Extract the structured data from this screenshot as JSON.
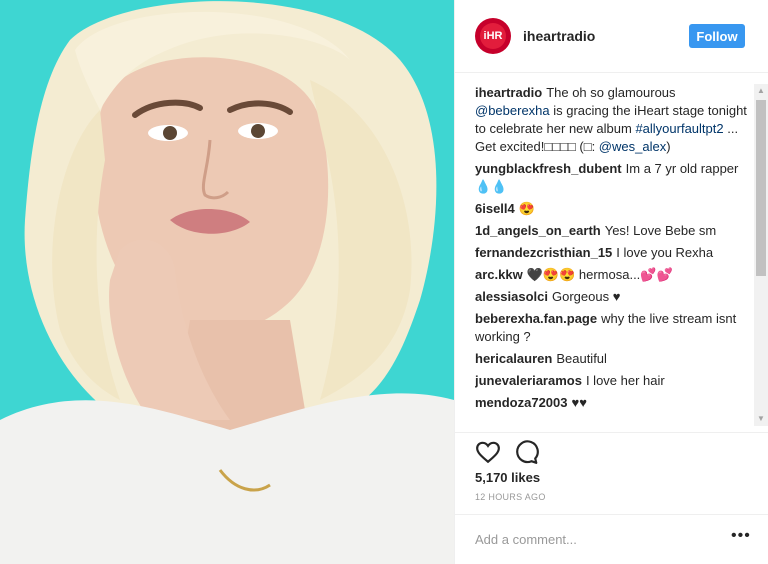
{
  "post": {
    "username": "iheartradio",
    "follow_label": "Follow",
    "caption_user": "iheartradio",
    "caption_parts": [
      "The oh so glamourous ",
      "@beberexha",
      " is gracing the iHeart stage tonight to celebrate her new album ",
      "#allyourfaultpt2",
      " ... Get excited!□□□□ (□: ",
      "@wes_alex",
      ")"
    ],
    "likes": "5,170 likes",
    "time": "12 HOURS AGO",
    "add_comment_placeholder": "Add a comment...",
    "more_label": "•••",
    "avatar_text": "iHR"
  },
  "comments": [
    {
      "user": "yungblackfresh_dubent",
      "text": "Im a 7 yr old rapper 💧💧"
    },
    {
      "user": "6isell4",
      "text": "😍"
    },
    {
      "user": "1d_angels_on_earth",
      "text": "Yes! Love Bebe sm"
    },
    {
      "user": "fernandezcristhian_15",
      "text": "I love you Rexha"
    },
    {
      "user": "arc.kkw",
      "text": "🖤😍😍 hermosa...💕💕"
    },
    {
      "user": "alessiasolci",
      "text": "Gorgeous ♥"
    },
    {
      "user": "beberexha.fan.page",
      "text": "why the live stream isnt working ?"
    },
    {
      "user": "hericalauren",
      "text": "Beautiful"
    },
    {
      "user": "junevaleriaramos",
      "text": "I love her hair"
    },
    {
      "user": "mendoza72003",
      "text": "♥♥"
    }
  ],
  "colors": {
    "accent": "#3897f0",
    "link": "#003569",
    "photo_bg": "#3ed6d2",
    "brand": "#c6002b"
  }
}
